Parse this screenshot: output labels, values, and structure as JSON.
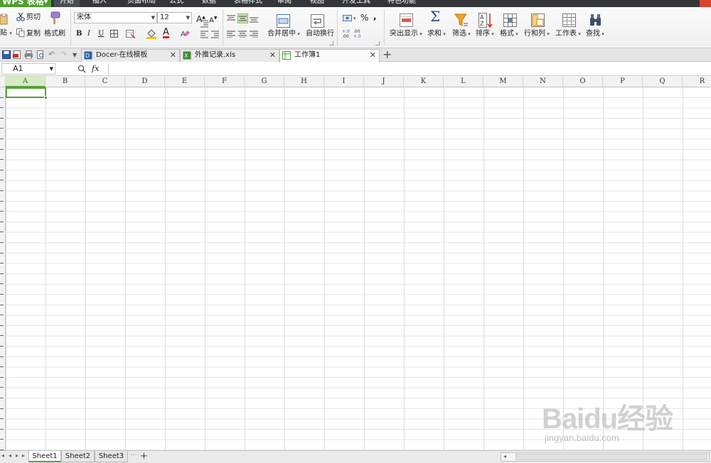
{
  "app": {
    "name": "WPS 表格",
    "brand_color": "#4f9f2d"
  },
  "menu": {
    "tabs": [
      "开始",
      "插入",
      "页面布局",
      "公式",
      "数据",
      "表格样式",
      "审阅",
      "视图",
      "开发工具",
      "特色功能"
    ],
    "active_tab": "开始"
  },
  "ribbon": {
    "clipboard": {
      "paste": "贴",
      "cut": "剪切",
      "copy": "复制",
      "format_painter": "格式刷"
    },
    "font": {
      "name": "宋体",
      "size": "12",
      "bold": "B",
      "italic": "I",
      "underline": "U"
    },
    "alignment": {
      "merge_center": "合并居中",
      "wrap_text": "自动换行"
    },
    "number": {
      "percent": "%",
      "comma": ","
    },
    "tools": {
      "conditional": "突出显示",
      "sum": "求和",
      "filter": "筛选",
      "sort": "排序",
      "format": "格式",
      "rows_cols": "行和列",
      "worksheet": "工作表",
      "find": "查找"
    }
  },
  "doc_tabs": [
    {
      "label": "Docer-在线模板",
      "icon": "docer-icon"
    },
    {
      "label": "外推记录.xls",
      "icon": "excel-file-icon"
    },
    {
      "label": "工作簿1",
      "icon": "workbook-icon",
      "active": true
    }
  ],
  "formula_bar": {
    "cell_ref": "A1",
    "fx": "fx",
    "value": ""
  },
  "grid": {
    "columns": [
      "A",
      "B",
      "C",
      "D",
      "E",
      "F",
      "G",
      "H",
      "I",
      "J",
      "K",
      "L",
      "M",
      "N",
      "O",
      "P",
      "Q",
      "R"
    ],
    "selected_column": "A",
    "active_cell": "A1"
  },
  "sheets": {
    "tabs": [
      "Sheet1",
      "Sheet2",
      "Sheet3"
    ],
    "active": "Sheet1",
    "more": "···",
    "add": "+"
  },
  "watermark": {
    "main": "Baidu经验",
    "sub": "jingyan.baidu.com"
  }
}
